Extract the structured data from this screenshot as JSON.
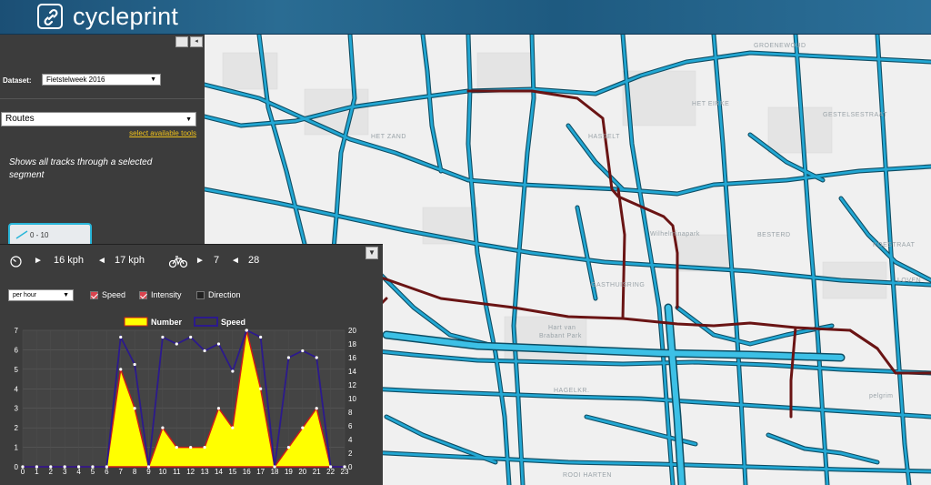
{
  "header": {
    "brand": "cycleprint"
  },
  "sidebar": {
    "dataset_label": "Dataset:",
    "dataset_value": "Fietstelweek 2016",
    "tool_value": "Routes",
    "select_tools_link": "select available tools",
    "description": "Shows all tracks through a selected segment",
    "legend_label": "0 - 10"
  },
  "map": {
    "labels": {
      "groenewoud": "GROENEWOUD",
      "het_eirke": "HET EIRKE",
      "het_zand": "HET ZAND",
      "hasselt": "HASSELT",
      "gestelsestraat": "GESTELSESTRAAT",
      "wilhelminapark": "Wilhelminapark",
      "bestetaart": "BESTERD",
      "koestraat": "KOESTRAAT",
      "loven": "LOVEN",
      "hart": "Hart van",
      "brabant": "Brabant Park",
      "gasthuisring": "GASTHUISRING",
      "hagelkruis": "HAGELKR.",
      "rooi_harten": "ROOI HARTEN",
      "pelgrimsplein": "pelgrim"
    },
    "colors": {
      "road_casing": "#0e4d63",
      "road_fill": "#22a7d3",
      "route": "#6a1414"
    }
  },
  "stats": {
    "speed_min": "16 kph",
    "speed_max": "17 kph",
    "count_min": "7",
    "count_max": "28",
    "period_select": "per hour",
    "check_speed": "Speed",
    "check_intensity": "Intensity",
    "check_direction": "Direction",
    "collapse": "▼"
  },
  "chart_data": {
    "type": "area",
    "legend": [
      "Number",
      "Speed"
    ],
    "legend_position": "top",
    "categories": [
      "0",
      "1",
      "2",
      "3",
      "4",
      "5",
      "6",
      "7",
      "8",
      "9",
      "10",
      "11",
      "12",
      "13",
      "14",
      "15",
      "16",
      "17",
      "18",
      "19",
      "20",
      "21",
      "22",
      "23"
    ],
    "series": [
      {
        "name": "Number",
        "axis": "left",
        "color": "#ffff00",
        "stroke": "#cc1a1a",
        "values": [
          0,
          0,
          0,
          0,
          0,
          0,
          0,
          5,
          3,
          0,
          2,
          1,
          1,
          1,
          3,
          2,
          7,
          4,
          0,
          1,
          2,
          3,
          0,
          0
        ]
      },
      {
        "name": "Speed",
        "axis": "right",
        "color": "#2c1a8c",
        "values": [
          0,
          0,
          0,
          0,
          0,
          0,
          0,
          19,
          15,
          0,
          19,
          18,
          19,
          17,
          18,
          14,
          20,
          19,
          0,
          16,
          17,
          16,
          0,
          0
        ]
      }
    ],
    "ylim_left": [
      0,
      7
    ],
    "yticks_left": [
      "0",
      "1",
      "2",
      "3",
      "4",
      "5",
      "6",
      "7"
    ],
    "ylim_right": [
      0,
      20
    ],
    "yticks_right": [
      "0",
      "2",
      "4",
      "6",
      "8",
      "10",
      "12",
      "14",
      "16",
      "18",
      "20"
    ],
    "grid": true
  }
}
